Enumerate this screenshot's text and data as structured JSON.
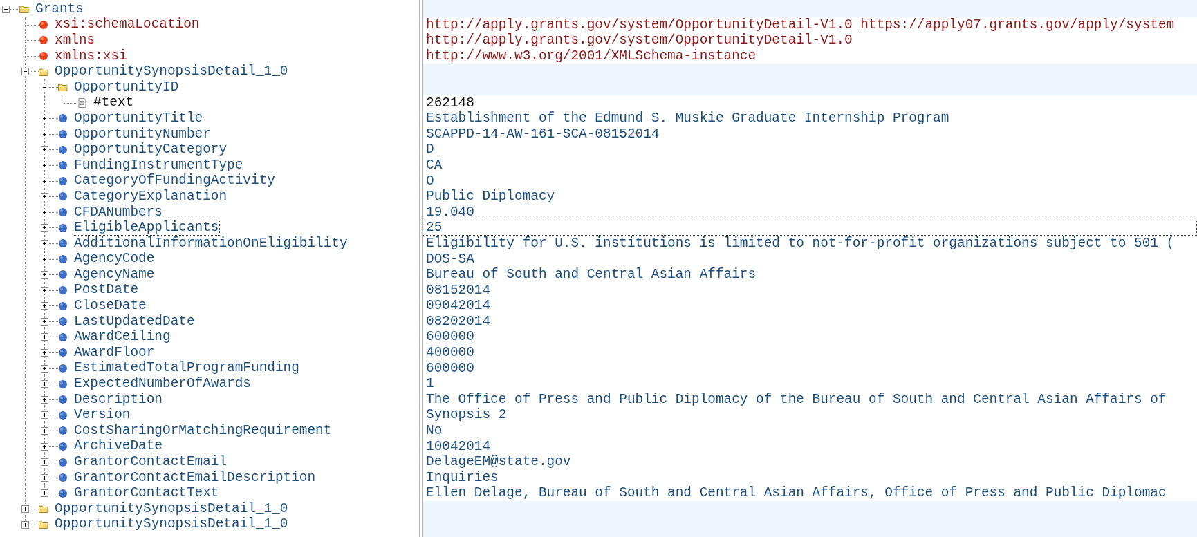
{
  "tree": [
    {
      "name": "Grants",
      "kind": "folder",
      "expanded": true,
      "selected": false,
      "children": [
        {
          "name": "xsi:schemaLocation",
          "kind": "attribute",
          "selected": false,
          "value": "http://apply.grants.gov/system/OpportunityDetail-V1.0 https://apply07.grants.gov/apply/system"
        },
        {
          "name": "xmlns",
          "kind": "attribute",
          "selected": false,
          "value": "http://apply.grants.gov/system/OpportunityDetail-V1.0"
        },
        {
          "name": "xmlns:xsi",
          "kind": "attribute",
          "selected": false,
          "value": "http://www.w3.org/2001/XMLSchema-instance"
        },
        {
          "name": "OpportunitySynopsisDetail_1_0",
          "kind": "folder",
          "expanded": true,
          "selected": false,
          "children": [
            {
              "name": "OpportunityID",
              "kind": "folder",
              "expanded": true,
              "selected": false,
              "children": [
                {
                  "name": "#text",
                  "kind": "text",
                  "selected": false,
                  "value": "262148"
                }
              ]
            },
            {
              "name": "OpportunityTitle",
              "kind": "element",
              "expanded": false,
              "selected": false,
              "value": "Establishment of the Edmund S. Muskie Graduate Internship Program"
            },
            {
              "name": "OpportunityNumber",
              "kind": "element",
              "expanded": false,
              "selected": false,
              "value": "SCAPPD-14-AW-161-SCA-08152014"
            },
            {
              "name": "OpportunityCategory",
              "kind": "element",
              "expanded": false,
              "selected": false,
              "value": "D"
            },
            {
              "name": "FundingInstrumentType",
              "kind": "element",
              "expanded": false,
              "selected": false,
              "value": "CA"
            },
            {
              "name": "CategoryOfFundingActivity",
              "kind": "element",
              "expanded": false,
              "selected": false,
              "value": "O"
            },
            {
              "name": "CategoryExplanation",
              "kind": "element",
              "expanded": false,
              "selected": false,
              "value": "Public Diplomacy"
            },
            {
              "name": "CFDANumbers",
              "kind": "element",
              "expanded": false,
              "selected": false,
              "value": "19.040"
            },
            {
              "name": "EligibleApplicants",
              "kind": "element",
              "expanded": false,
              "selected": true,
              "value": "25"
            },
            {
              "name": "AdditionalInformationOnEligibility",
              "kind": "element",
              "expanded": false,
              "selected": false,
              "value": "Eligibility for U.S. institutions is limited to not-for-profit organizations subject to 501 ("
            },
            {
              "name": "AgencyCode",
              "kind": "element",
              "expanded": false,
              "selected": false,
              "value": "DOS-SA"
            },
            {
              "name": "AgencyName",
              "kind": "element",
              "expanded": false,
              "selected": false,
              "value": "Bureau of South and Central Asian Affairs"
            },
            {
              "name": "PostDate",
              "kind": "element",
              "expanded": false,
              "selected": false,
              "value": "08152014"
            },
            {
              "name": "CloseDate",
              "kind": "element",
              "expanded": false,
              "selected": false,
              "value": "09042014"
            },
            {
              "name": "LastUpdatedDate",
              "kind": "element",
              "expanded": false,
              "selected": false,
              "value": "08202014"
            },
            {
              "name": "AwardCeiling",
              "kind": "element",
              "expanded": false,
              "selected": false,
              "value": "600000"
            },
            {
              "name": "AwardFloor",
              "kind": "element",
              "expanded": false,
              "selected": false,
              "value": "400000"
            },
            {
              "name": "EstimatedTotalProgramFunding",
              "kind": "element",
              "expanded": false,
              "selected": false,
              "value": "600000"
            },
            {
              "name": "ExpectedNumberOfAwards",
              "kind": "element",
              "expanded": false,
              "selected": false,
              "value": "1"
            },
            {
              "name": "Description",
              "kind": "element",
              "expanded": false,
              "selected": false,
              "value": "The Office of Press and Public Diplomacy of the Bureau of South and Central Asian Affairs of"
            },
            {
              "name": "Version",
              "kind": "element",
              "expanded": false,
              "selected": false,
              "value": "Synopsis 2"
            },
            {
              "name": "CostSharingOrMatchingRequirement",
              "kind": "element",
              "expanded": false,
              "selected": false,
              "value": "No"
            },
            {
              "name": "ArchiveDate",
              "kind": "element",
              "expanded": false,
              "selected": false,
              "value": "10042014"
            },
            {
              "name": "GrantorContactEmail",
              "kind": "element",
              "expanded": false,
              "selected": false,
              "value": "DelageEM@state.gov"
            },
            {
              "name": "GrantorContactEmailDescription",
              "kind": "element",
              "expanded": false,
              "selected": false,
              "value": "Inquiries"
            },
            {
              "name": "GrantorContactText",
              "kind": "element",
              "expanded": false,
              "selected": false,
              "value": "Ellen Delage, Bureau of South and Central Asian Affairs,  Office of Press and Public Diplomac"
            }
          ]
        },
        {
          "name": "OpportunitySynopsisDetail_1_0",
          "kind": "folder",
          "expanded": false,
          "selected": false
        },
        {
          "name": "OpportunitySynopsisDetail_1_0",
          "kind": "folder",
          "expanded": false,
          "selected": false
        }
      ]
    }
  ]
}
